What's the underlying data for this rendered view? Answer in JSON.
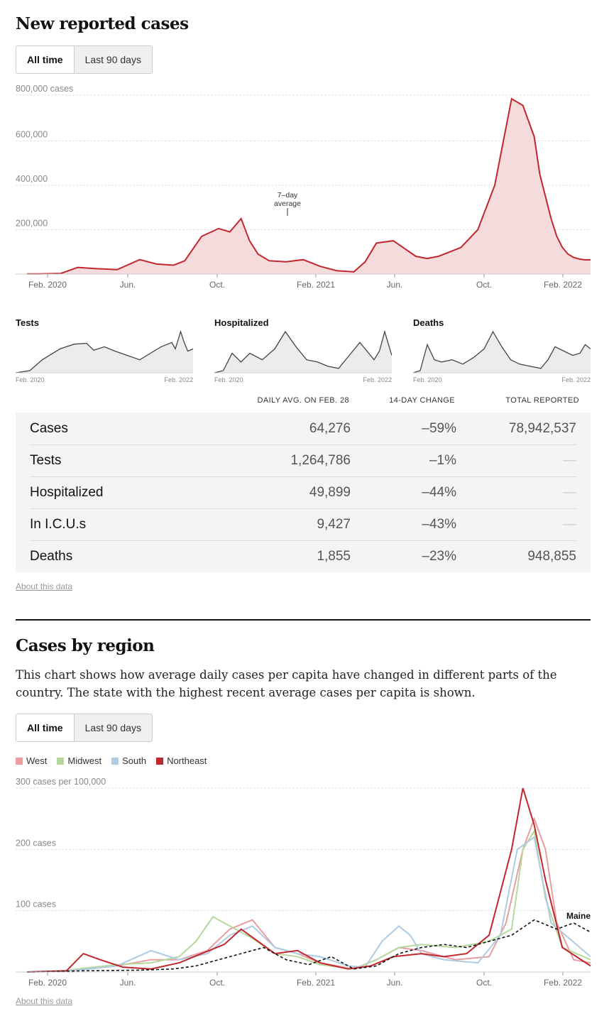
{
  "section1": {
    "title": "New reported cases",
    "toggle": {
      "all_time": "All time",
      "last_90": "Last 90 days"
    },
    "annotation": {
      "line1": "7–day",
      "line2": "average"
    }
  },
  "chart_data": [
    {
      "type": "area",
      "title": "New reported cases",
      "ylabel": "800,000 cases",
      "yticks": [
        "800,000 cases",
        "600,000",
        "400,000",
        "200,000"
      ],
      "ylim": [
        0,
        800000
      ],
      "xticks": [
        "Feb. 2020",
        "Jun.",
        "Oct.",
        "Feb. 2021",
        "Jun.",
        "Oct.",
        "Feb. 2022"
      ],
      "colors": {
        "line": "#c1272d",
        "fill": "#f5dbdc"
      },
      "x": [
        0,
        0.02,
        0.06,
        0.09,
        0.12,
        0.16,
        0.2,
        0.23,
        0.26,
        0.28,
        0.31,
        0.34,
        0.36,
        0.38,
        0.395,
        0.41,
        0.43,
        0.46,
        0.49,
        0.52,
        0.55,
        0.58,
        0.6,
        0.62,
        0.65,
        0.67,
        0.69,
        0.71,
        0.73,
        0.75,
        0.77,
        0.8,
        0.83,
        0.86,
        0.88,
        0.9,
        0.91,
        0.93,
        0.94,
        0.95,
        0.96,
        0.97,
        0.98,
        0.99,
        1
      ],
      "values": [
        1000,
        1000,
        3000,
        30000,
        25000,
        20000,
        65000,
        45000,
        40000,
        60000,
        170000,
        205000,
        190000,
        250000,
        150000,
        90000,
        60000,
        55000,
        65000,
        35000,
        15000,
        10000,
        55000,
        140000,
        150000,
        115000,
        80000,
        70000,
        80000,
        100000,
        120000,
        200000,
        400000,
        790000,
        760000,
        620000,
        450000,
        250000,
        170000,
        120000,
        90000,
        75000,
        68000,
        64000,
        64276
      ]
    },
    {
      "type": "area",
      "title": "Tests",
      "xticks": [
        "Feb. 2020",
        "Feb. 2022"
      ],
      "x": [
        0,
        0.08,
        0.15,
        0.25,
        0.33,
        0.4,
        0.44,
        0.5,
        0.56,
        0.63,
        0.7,
        0.76,
        0.82,
        0.88,
        0.9,
        0.93,
        0.95,
        0.97,
        1
      ],
      "values": [
        0,
        0.05,
        0.3,
        0.55,
        0.66,
        0.68,
        0.52,
        0.6,
        0.5,
        0.4,
        0.3,
        0.45,
        0.6,
        0.7,
        0.55,
        0.95,
        0.7,
        0.5,
        0.55
      ]
    },
    {
      "type": "area",
      "title": "Hospitalized",
      "xticks": [
        "Feb. 2020",
        "Feb. 2022"
      ],
      "x": [
        0,
        0.05,
        0.1,
        0.15,
        0.2,
        0.27,
        0.34,
        0.4,
        0.46,
        0.52,
        0.58,
        0.64,
        0.7,
        0.76,
        0.82,
        0.86,
        0.9,
        0.93,
        0.96,
        1
      ],
      "values": [
        0,
        0.05,
        0.45,
        0.25,
        0.45,
        0.3,
        0.55,
        0.95,
        0.6,
        0.3,
        0.25,
        0.15,
        0.1,
        0.4,
        0.7,
        0.5,
        0.3,
        0.5,
        0.95,
        0.4
      ]
    },
    {
      "type": "area",
      "title": "Deaths",
      "xticks": [
        "Feb. 2020",
        "Feb. 2022"
      ],
      "x": [
        0,
        0.04,
        0.08,
        0.12,
        0.16,
        0.22,
        0.28,
        0.34,
        0.4,
        0.45,
        0.5,
        0.55,
        0.6,
        0.66,
        0.72,
        0.76,
        0.8,
        0.85,
        0.9,
        0.94,
        0.97,
        1
      ],
      "values": [
        0,
        0.05,
        0.65,
        0.3,
        0.25,
        0.3,
        0.2,
        0.35,
        0.55,
        0.95,
        0.6,
        0.3,
        0.2,
        0.15,
        0.1,
        0.3,
        0.6,
        0.5,
        0.4,
        0.45,
        0.65,
        0.55
      ]
    },
    {
      "type": "line",
      "title": "Cases by region",
      "ylabel": "300 cases per 100,000",
      "yticks": [
        "300 cases per 100,000",
        "200 cases",
        "100 cases"
      ],
      "ylim": [
        0,
        300
      ],
      "xticks": [
        "Feb. 2020",
        "Jun.",
        "Oct.",
        "Feb. 2021",
        "Jun.",
        "Oct.",
        "Feb. 2022"
      ],
      "annotation": "Maine",
      "series": [
        {
          "name": "West",
          "color": "#e89ea0",
          "x": [
            0,
            0.06,
            0.1,
            0.16,
            0.22,
            0.27,
            0.32,
            0.36,
            0.4,
            0.44,
            0.48,
            0.52,
            0.58,
            0.62,
            0.66,
            0.7,
            0.76,
            0.82,
            0.85,
            0.88,
            0.9,
            0.92,
            0.94,
            0.97,
            1
          ],
          "values": [
            0,
            1,
            5,
            10,
            20,
            20,
            35,
            70,
            85,
            40,
            30,
            15,
            5,
            20,
            40,
            35,
            20,
            25,
            80,
            200,
            250,
            200,
            80,
            20,
            15
          ]
        },
        {
          "name": "Midwest",
          "color": "#b5d99c",
          "x": [
            0,
            0.06,
            0.1,
            0.16,
            0.22,
            0.27,
            0.3,
            0.33,
            0.37,
            0.4,
            0.44,
            0.48,
            0.52,
            0.58,
            0.62,
            0.66,
            0.7,
            0.76,
            0.82,
            0.86,
            0.88,
            0.9,
            0.92,
            0.95,
            1
          ],
          "values": [
            0,
            1,
            6,
            12,
            15,
            25,
            50,
            90,
            70,
            55,
            30,
            25,
            12,
            5,
            20,
            40,
            45,
            40,
            50,
            70,
            200,
            230,
            120,
            40,
            20
          ]
        },
        {
          "name": "South",
          "color": "#aecbe1",
          "x": [
            0,
            0.06,
            0.1,
            0.16,
            0.22,
            0.27,
            0.32,
            0.36,
            0.4,
            0.44,
            0.48,
            0.52,
            0.57,
            0.6,
            0.63,
            0.66,
            0.68,
            0.7,
            0.74,
            0.8,
            0.84,
            0.87,
            0.9,
            0.93,
            1
          ],
          "values": [
            0,
            1,
            4,
            10,
            35,
            20,
            30,
            60,
            75,
            40,
            30,
            25,
            10,
            8,
            50,
            75,
            60,
            30,
            20,
            15,
            60,
            200,
            220,
            80,
            25
          ]
        },
        {
          "name": "Northeast",
          "color": "#c1272d",
          "x": [
            0,
            0.07,
            0.1,
            0.13,
            0.17,
            0.22,
            0.27,
            0.31,
            0.35,
            0.38,
            0.41,
            0.44,
            0.48,
            0.52,
            0.57,
            0.61,
            0.65,
            0.7,
            0.74,
            0.78,
            0.82,
            0.86,
            0.88,
            0.9,
            0.92,
            0.95,
            1
          ],
          "values": [
            0,
            2,
            30,
            20,
            8,
            5,
            15,
            30,
            45,
            70,
            50,
            30,
            35,
            15,
            5,
            10,
            25,
            30,
            25,
            30,
            60,
            200,
            300,
            240,
            150,
            40,
            10
          ]
        },
        {
          "name": "Maine",
          "color": "#121212",
          "dashed": true,
          "x": [
            0,
            0.1,
            0.2,
            0.26,
            0.3,
            0.34,
            0.38,
            0.42,
            0.46,
            0.5,
            0.54,
            0.58,
            0.62,
            0.66,
            0.7,
            0.74,
            0.78,
            0.82,
            0.86,
            0.9,
            0.94,
            0.97,
            1
          ],
          "values": [
            0,
            2,
            3,
            5,
            10,
            20,
            30,
            40,
            20,
            12,
            25,
            5,
            10,
            30,
            40,
            45,
            40,
            50,
            60,
            85,
            70,
            80,
            65
          ]
        }
      ]
    }
  ],
  "small_multiples": {
    "tests_title": "Tests",
    "hosp_title": "Hospitalized",
    "deaths_title": "Deaths",
    "start_label": "Feb. 2020",
    "end_label": "Feb. 2022"
  },
  "table": {
    "headers": {
      "daily": "DAILY AVG. ON FEB. 28",
      "change": "14-DAY CHANGE",
      "total": "TOTAL REPORTED"
    },
    "rows": [
      {
        "name": "Cases",
        "daily": "64,276",
        "change": "–59%",
        "total": "78,942,537"
      },
      {
        "name": "Tests",
        "daily": "1,264,786",
        "change": "–1%",
        "total": "—"
      },
      {
        "name": "Hospitalized",
        "daily": "49,899",
        "change": "–44%",
        "total": "—"
      },
      {
        "name": "In I.C.U.s",
        "daily": "9,427",
        "change": "–43%",
        "total": "—"
      },
      {
        "name": "Deaths",
        "daily": "1,855",
        "change": "–23%",
        "total": "948,855"
      }
    ],
    "about": "About this data"
  },
  "section2": {
    "title": "Cases by region",
    "description": "This chart shows how average daily cases per capita have changed in different parts of the country. The state with the highest recent average cases per capita is shown.",
    "toggle": {
      "all_time": "All time",
      "last_90": "Last 90 days"
    },
    "legend": [
      {
        "name": "West",
        "color": "#e89ea0"
      },
      {
        "name": "Midwest",
        "color": "#b5d99c"
      },
      {
        "name": "South",
        "color": "#aecbe1"
      },
      {
        "name": "Northeast",
        "color": "#c1272d"
      }
    ],
    "about": "About this data"
  }
}
